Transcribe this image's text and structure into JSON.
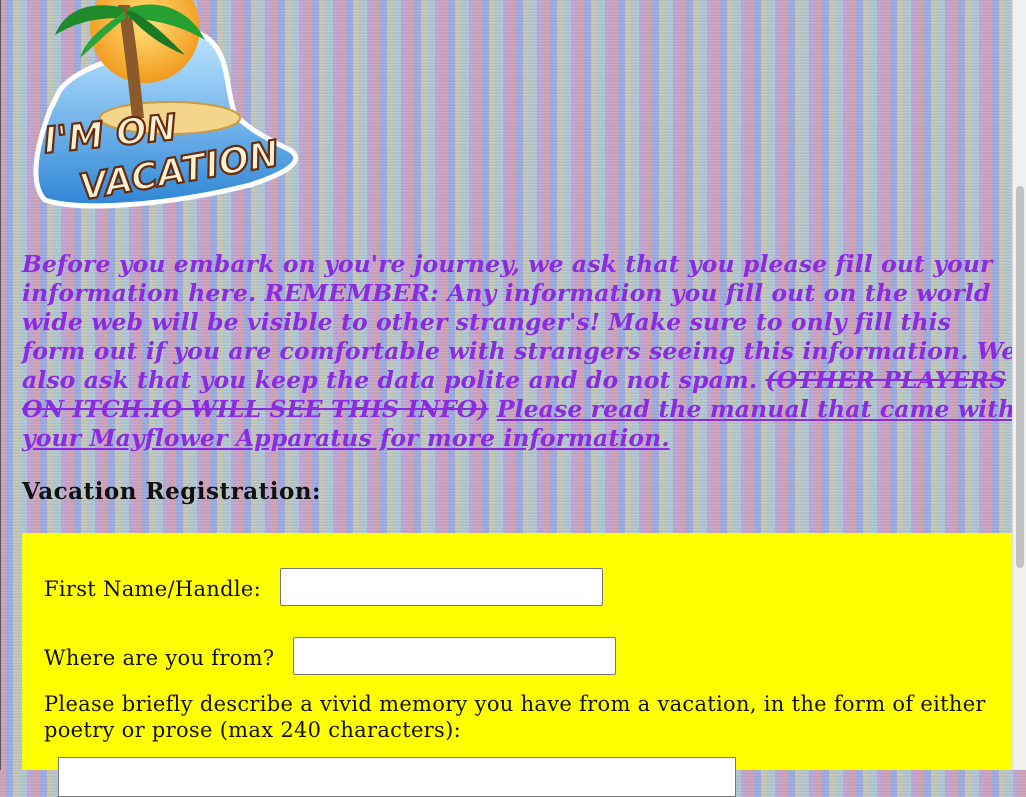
{
  "logo": {
    "line1": "I'M ON",
    "line2": "VACATION"
  },
  "intro": {
    "text": "Before you embark on you're journey, we ask that you please fill out your information here. REMEMBER: Any information you fill out on the world wide web will be visible to other stranger's! Make sure to only fill this form out if you are comfortable with strangers seeing this information. We also ask that you keep the data polite and do not spam. ",
    "strike_text": "(OTHER PLAYERS ON ITCH.IO WILL SEE THIS INFO)",
    "link_text": "Please read the manual that came with your Mayflower Apparatus for more information."
  },
  "registration": {
    "heading": "Vacation Registration:",
    "first_name_label": "First Name/Handle:",
    "first_name_value": "",
    "origin_label": "Where are you from?",
    "origin_value": "",
    "memory_label": "Please briefly describe a vivid memory you have from a vacation, in the form of either poetry or prose (max 240 characters):",
    "memory_value": ""
  },
  "colors": {
    "intro_text": "#8a2be2",
    "form_background": "#ffff00"
  }
}
